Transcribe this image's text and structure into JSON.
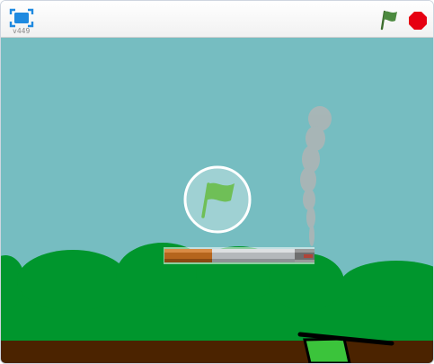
{
  "player": {
    "version_label": "v449"
  },
  "controls": {
    "fullscreen_icon": "fullscreen-icon",
    "green_flag_icon": "green-flag-icon",
    "stop_icon": "stop-sign-icon"
  },
  "stage": {
    "overlay_icon": "green-flag-icon",
    "sprites": [
      "cigarette",
      "smoke",
      "hand"
    ]
  },
  "colors": {
    "sky": "#76bdc1",
    "bushes": "#00962d",
    "ground": "#4b2300",
    "flag_green": "#4c8a3f",
    "stop_red": "#e60012",
    "overlay_flag": "#6fbf57"
  }
}
